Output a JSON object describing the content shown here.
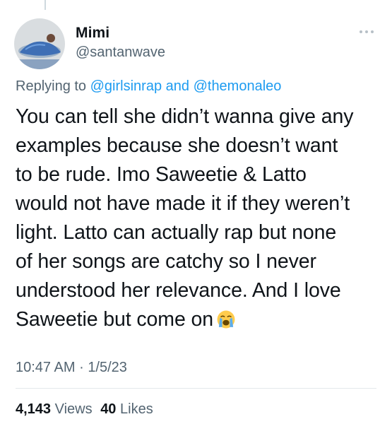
{
  "user": {
    "display_name": "Mimi",
    "handle": "@santanwave"
  },
  "reply": {
    "prefix": "Replying to",
    "mention_1": "@girlsinrap",
    "conjunction": "and",
    "mention_2": "@themonaleo"
  },
  "tweet": {
    "lines": [
      "You can tell she didn’t wanna give any",
      "examples because she doesn’t want",
      "to be rude. Imo Saweetie & Latto",
      "would not have made it if they weren’t",
      "light. Latto can actually rap but none",
      "of her songs are catchy so I never",
      "understood her relevance. And I love",
      "Saweetie but come on"
    ],
    "emoji": "loudly-crying-face"
  },
  "meta": {
    "time": "10:47 AM",
    "separator": "·",
    "date": "1/5/23"
  },
  "stats": {
    "views_count": "4,143",
    "views_label": "Views",
    "likes_count": "40",
    "likes_label": "Likes"
  },
  "colors": {
    "text": "#0f1419",
    "secondary": "#536471",
    "link": "#1d9bf0"
  }
}
